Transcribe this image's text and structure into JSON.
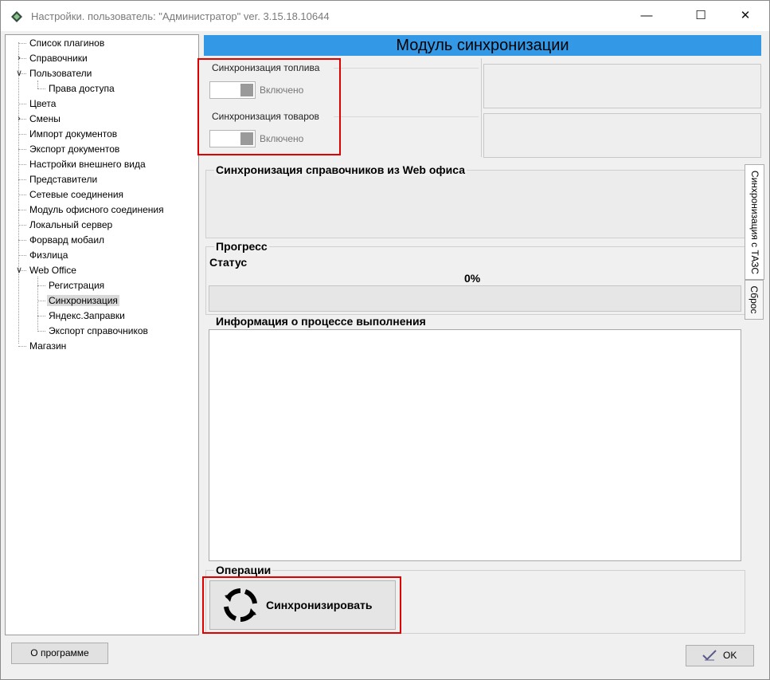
{
  "window": {
    "title": "Настройки. пользователь: \"Администратор\" ver. 3.15.18.10644",
    "minimize": "—",
    "maximize": "☐",
    "close": "✕"
  },
  "tree": {
    "items": [
      {
        "label": "Список плагинов"
      },
      {
        "label": "Справочники",
        "expander": "›"
      },
      {
        "label": "Пользователи",
        "expander": "∨"
      },
      {
        "label": "Права доступа"
      },
      {
        "label": "Цвета"
      },
      {
        "label": "Смены",
        "expander": "›"
      },
      {
        "label": "Импорт документов"
      },
      {
        "label": "Экспорт документов"
      },
      {
        "label": "Настройки внешнего вида"
      },
      {
        "label": "Представители"
      },
      {
        "label": "Сетевые соединения"
      },
      {
        "label": "Модуль офисного соединения"
      },
      {
        "label": "Локальный сервер"
      },
      {
        "label": "Форвард мобаил"
      },
      {
        "label": "Физлица"
      },
      {
        "label": "Web Office",
        "expander": "∨"
      },
      {
        "label": "Регистрация"
      },
      {
        "label": "Синхронизация",
        "selected": true
      },
      {
        "label": "Яндекс.Заправки"
      },
      {
        "label": "Экспорт справочников"
      },
      {
        "label": "Магазин"
      }
    ]
  },
  "header": {
    "title": "Модуль синхронизации"
  },
  "fuel_sync": {
    "label": "Синхронизация топлива",
    "state_label": "Включено"
  },
  "goods_sync": {
    "label": "Синхронизация товаров",
    "state_label": "Включено"
  },
  "sections": {
    "web_office": "Синхронизация справочников из Web офиса",
    "progress": "Прогресс",
    "status": "Статус",
    "info": "Информация о процессе выполнения",
    "operations": "Операции"
  },
  "progress": {
    "percent_label": "0%",
    "value": 0
  },
  "sync_button": {
    "label": "Синхронизировать"
  },
  "side_tabs": {
    "tab1": "Синхронизация с ТАЗС",
    "tab2": "Сброс"
  },
  "footer": {
    "about_label": "О программе",
    "ok_label": "OK"
  },
  "colors": {
    "header_bg": "#3399e6",
    "highlight_border": "#e00000"
  }
}
